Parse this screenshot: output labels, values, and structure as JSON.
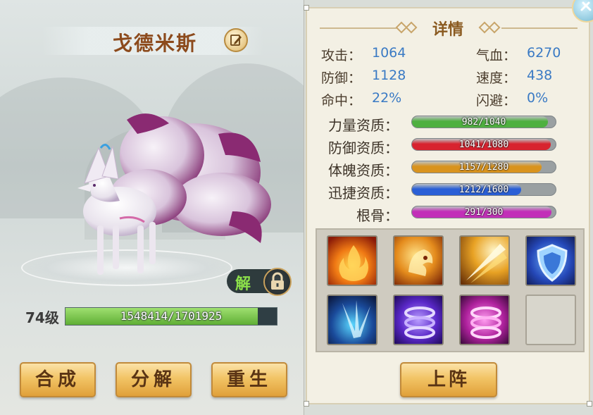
{
  "pet": {
    "name": "戈德米斯",
    "level_label": "74级",
    "exp_text": "1548414/1701925",
    "exp_current": 1548414,
    "exp_max": 1701925,
    "release_label": "解"
  },
  "actions": {
    "synthesize": "合成",
    "decompose": "分解",
    "rebirth": "重生"
  },
  "details": {
    "title": "详情",
    "stats": [
      {
        "label": "攻击：",
        "value": "1064"
      },
      {
        "label": "气血：",
        "value": "6270"
      },
      {
        "label": "防御：",
        "value": "1128"
      },
      {
        "label": "速度：",
        "value": "438"
      },
      {
        "label": "命中：",
        "value": "22%"
      },
      {
        "label": "闪避：",
        "value": "0%"
      }
    ],
    "aptitudes": [
      {
        "label": "力量资质：",
        "text": "982/1040",
        "current": 982,
        "max": 1040,
        "color": "#4fb040"
      },
      {
        "label": "防御资质：",
        "text": "1041/1080",
        "current": 1041,
        "max": 1080,
        "color": "#d8232f"
      },
      {
        "label": "体魄资质：",
        "text": "1157/1280",
        "current": 1157,
        "max": 1280,
        "color": "#d9931e"
      },
      {
        "label": "迅捷资质：",
        "text": "1212/1600",
        "current": 1212,
        "max": 1600,
        "color": "#2a5fd6"
      },
      {
        "label": "根骨：",
        "text": "291/300",
        "current": 291,
        "max": 300,
        "color": "#c22fb8"
      }
    ],
    "skills": [
      {
        "icon": "fire-skill-icon"
      },
      {
        "icon": "flame-beast-skill-icon"
      },
      {
        "icon": "golden-strike-skill-icon"
      },
      {
        "icon": "shield-skill-icon"
      },
      {
        "icon": "ice-shatter-skill-icon"
      },
      {
        "icon": "purple-vortex-skill-icon"
      },
      {
        "icon": "magenta-vortex-skill-icon"
      },
      {
        "icon": "empty-skill-slot"
      }
    ],
    "deploy_label": "上阵"
  }
}
